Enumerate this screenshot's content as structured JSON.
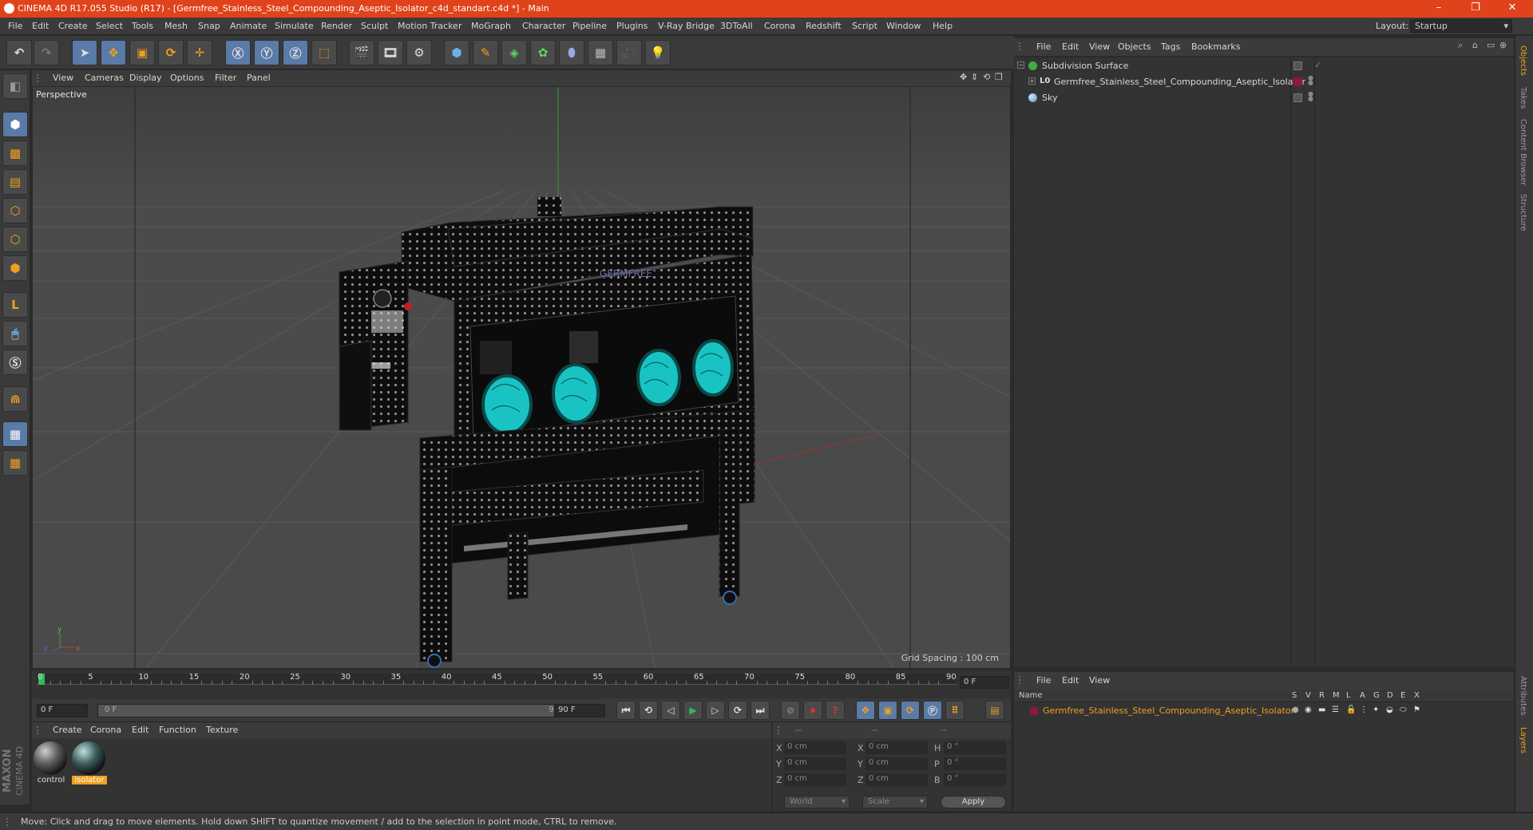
{
  "titlebar": {
    "title": "CINEMA 4D R17.055 Studio (R17) - [Germfree_Stainless_Steel_Compounding_Aseptic_Isolator_c4d_standart.c4d *] - Main",
    "minimize": "–",
    "restore": "❐",
    "close": "✕"
  },
  "menubar": {
    "items": [
      "File",
      "Edit",
      "Create",
      "Select",
      "Tools",
      "Mesh",
      "Snap",
      "Animate",
      "Simulate",
      "Render",
      "Sculpt",
      "Motion Tracker",
      "MoGraph",
      "Character",
      "Pipeline",
      "Plugins",
      "V-Ray Bridge",
      "3DToAll",
      "Corona",
      "Redshift",
      "Script",
      "Window",
      "Help"
    ],
    "layout_label": "Layout:",
    "layout_value": "Startup"
  },
  "viewport": {
    "menu": [
      "View",
      "Cameras",
      "Display",
      "Options",
      "Filter",
      "Panel"
    ],
    "label": "Perspective",
    "grid_spacing": "Grid Spacing : 100 cm",
    "brand_text": "GERMFREE"
  },
  "timeline": {
    "ticks": [
      "0",
      "5",
      "10",
      "15",
      "20",
      "25",
      "30",
      "35",
      "40",
      "45",
      "50",
      "55",
      "60",
      "65",
      "70",
      "75",
      "80",
      "85",
      "90"
    ],
    "end_frame": "0 F",
    "start_field": "0 F",
    "range_start": "0 F",
    "range_end": "90 F",
    "end_field": "90 F"
  },
  "material_manager": {
    "menu": [
      "Create",
      "Corona",
      "Edit",
      "Function",
      "Texture"
    ],
    "materials": [
      {
        "name": "control",
        "selected": false
      },
      {
        "name": "isolator",
        "selected": true
      }
    ]
  },
  "coords": {
    "headers": [
      "--",
      "--",
      "--"
    ],
    "rows": [
      {
        "a": "X",
        "av": "0 cm",
        "b": "X",
        "bv": "0 cm",
        "c": "H",
        "cv": "0 °"
      },
      {
        "a": "Y",
        "av": "0 cm",
        "b": "Y",
        "bv": "0 cm",
        "c": "P",
        "cv": "0 °"
      },
      {
        "a": "Z",
        "av": "0 cm",
        "b": "Z",
        "bv": "0 cm",
        "c": "B",
        "cv": "0 °"
      }
    ],
    "mode": "World",
    "scale": "Scale",
    "apply": "Apply"
  },
  "status": {
    "text": "Move: Click and drag to move elements. Hold down SHIFT to quantize movement / add to the selection in point mode, CTRL to remove."
  },
  "object_manager": {
    "menu": [
      "File",
      "Edit",
      "View",
      "Objects",
      "Tags",
      "Bookmarks"
    ],
    "objects": [
      {
        "name": "Subdivision Surface",
        "indent": 0
      },
      {
        "name": "Germfree_Stainless_Steel_Compounding_Aseptic_Isolator",
        "indent": 1
      },
      {
        "name": "Sky",
        "indent": 0
      }
    ]
  },
  "layer_manager": {
    "menu": [
      "File",
      "Edit",
      "View"
    ],
    "columns": [
      "Name",
      "S",
      "V",
      "R",
      "M",
      "L",
      "A",
      "G",
      "D",
      "E",
      "X"
    ],
    "layers": [
      {
        "name": "Germfree_Stainless_Steel_Compounding_Aseptic_Isolator"
      }
    ]
  },
  "side_tabs": {
    "top": [
      "Objects",
      "Takes",
      "Content Browser",
      "Structure"
    ],
    "bottom": [
      "Attributes",
      "Layers"
    ]
  },
  "branding": {
    "line1": "MAXON",
    "line2": "CINEMA 4D"
  },
  "colors": {
    "accent": "#e0431b",
    "selection": "#f0a020",
    "glass": "#19c3c3"
  }
}
